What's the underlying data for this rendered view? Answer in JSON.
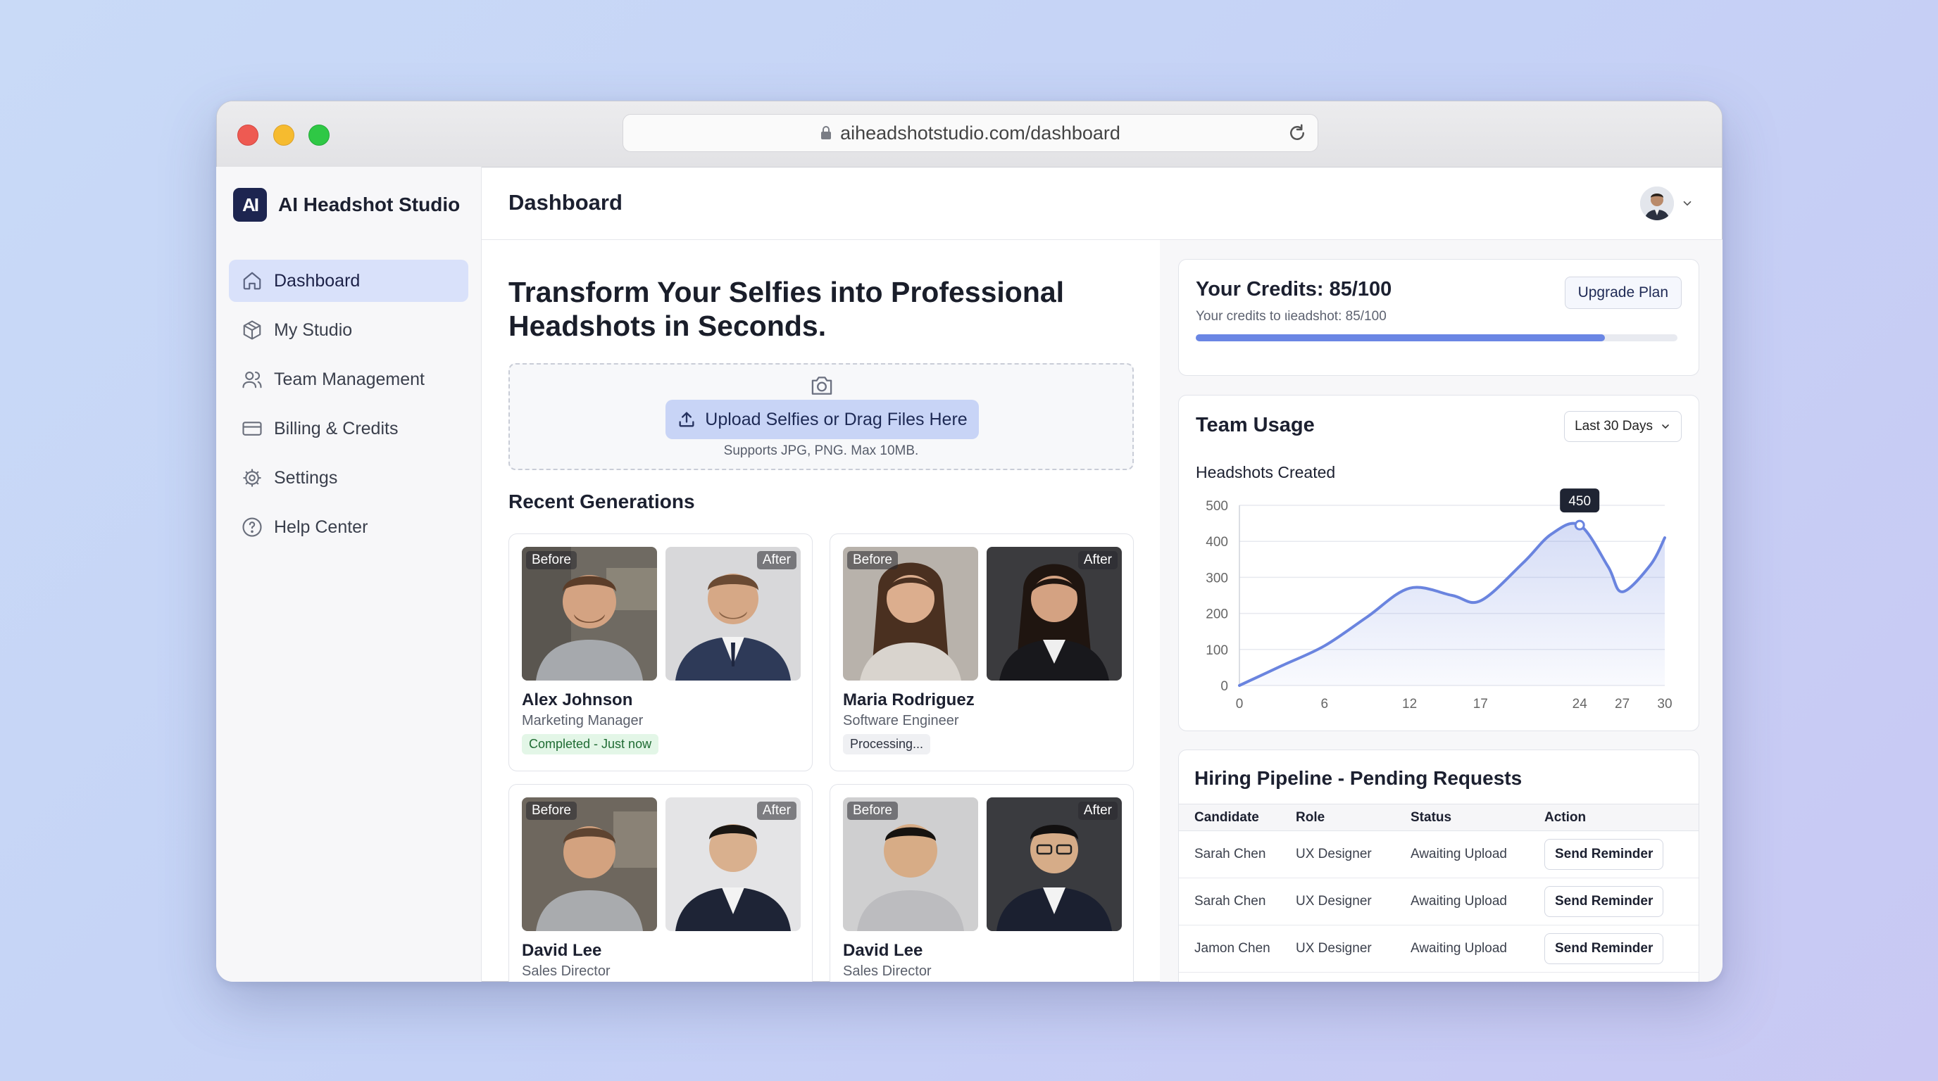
{
  "browser": {
    "url": "aiheadshotstudio.com/dashboard"
  },
  "sidebar": {
    "brand_logo": "AI",
    "brand_name": "AI Headshot Studio",
    "items": [
      {
        "label": "Dashboard",
        "icon": "home-icon",
        "active": true
      },
      {
        "label": "My Studio",
        "icon": "box-icon"
      },
      {
        "label": "Team Management",
        "icon": "users-icon"
      },
      {
        "label": "Billing & Credits",
        "icon": "credit-card-icon"
      },
      {
        "label": "Settings",
        "icon": "gear-icon"
      },
      {
        "label": "Help Center",
        "icon": "help-icon"
      }
    ]
  },
  "header": {
    "title": "Dashboard"
  },
  "hero": {
    "title": "Transform Your Selfies into Professional Headshots in Seconds."
  },
  "upload": {
    "button_label": "Upload Selfies or Drag Files Here",
    "note": "Supports JPG, PNG. Max 10MB."
  },
  "recent": {
    "title": "Recent Generations",
    "before_label": "Before",
    "after_label": "After",
    "cards": [
      {
        "name": "Alex Johnson",
        "role": "Marketing Manager",
        "status": "Completed - Just now",
        "status_type": "success"
      },
      {
        "name": "Maria Rodriguez",
        "role": "Software Engineer",
        "status": "Processing...",
        "status_type": "pending"
      },
      {
        "name": "David Lee",
        "role": "Sales Director"
      },
      {
        "name": "David Lee",
        "role": "Sales Director"
      }
    ]
  },
  "credits": {
    "title": "Your Credits: 85/100",
    "subtitle": "Your credits to ιieadshot: 85/100",
    "used": 85,
    "total": 100,
    "upgrade_label": "Upgrade Plan"
  },
  "usage": {
    "title": "Team Usage",
    "range": "Last 30 Days",
    "chart_title": "Headshots Created",
    "peak_tooltip": "450"
  },
  "chart_data": {
    "type": "area",
    "title": "Headshots Created",
    "x": [
      0,
      3,
      6,
      9,
      12,
      15,
      17,
      20,
      22,
      24,
      26,
      27,
      29,
      30
    ],
    "y": [
      0,
      55,
      110,
      190,
      270,
      250,
      235,
      340,
      420,
      445,
      330,
      260,
      335,
      410
    ],
    "xticks": [
      0,
      6,
      12,
      17,
      24,
      27,
      30
    ],
    "yticks": [
      0,
      100,
      200,
      300,
      400,
      500
    ],
    "xlim": [
      0,
      30
    ],
    "ylim": [
      0,
      500
    ],
    "grid": true,
    "highlight": {
      "x": 24,
      "label": "450"
    },
    "color": "#6a84df"
  },
  "pipeline": {
    "title": "Hiring Pipeline - Pending Requests",
    "columns": [
      "Candidate",
      "Role",
      "Status",
      "Action"
    ],
    "rows": [
      {
        "candidate": "Sarah Chen",
        "role": "UX Designer",
        "status": "Awaiting Upload",
        "action": "Send Reminder"
      },
      {
        "candidate": "Sarah Chen",
        "role": "UX Designer",
        "status": "Awaiting Upload",
        "action": "Send Reminder"
      },
      {
        "candidate": "Jamon Chen",
        "role": "UX Designer",
        "status": "Awaiting Upload",
        "action": "Send Reminder"
      }
    ]
  },
  "colors": {
    "accent": "#6a86e4",
    "brand": "#1d2550",
    "active_nav": "#d9e1fa",
    "success_bg": "#e3f6e7",
    "success_text": "#1f6b33"
  }
}
